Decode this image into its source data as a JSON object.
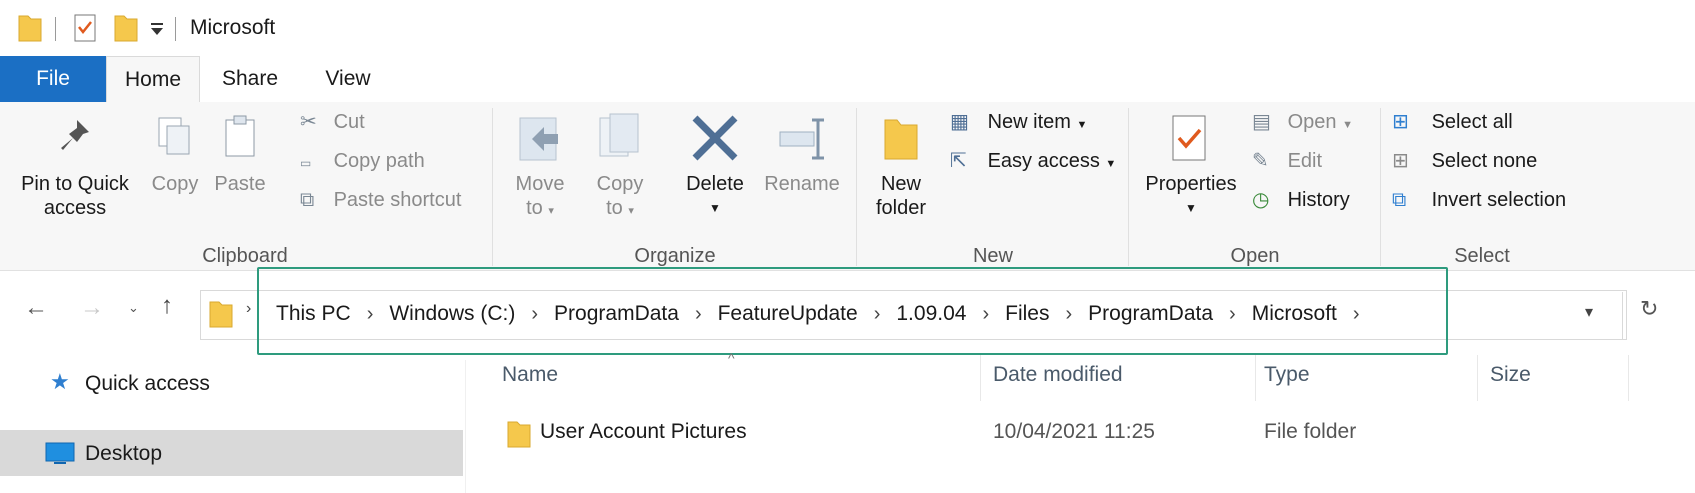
{
  "window": {
    "title": "Microsoft"
  },
  "ribbon_tabs": [
    "File",
    "Home",
    "Share",
    "View"
  ],
  "clipboard": {
    "label": "Clipboard",
    "pin_line1": "Pin to Quick",
    "pin_line2": "access",
    "copy": "Copy",
    "paste": "Paste",
    "cut": "Cut",
    "copy_path": "Copy path",
    "paste_shortcut": "Paste shortcut"
  },
  "organize": {
    "label": "Organize",
    "move_line1": "Move",
    "move_line2": "to",
    "copy_line1": "Copy",
    "copy_line2": "to",
    "delete": "Delete",
    "rename": "Rename"
  },
  "new_group": {
    "label": "New",
    "new_folder_line1": "New",
    "new_folder_line2": "folder",
    "new_item": "New item",
    "easy_access": "Easy access"
  },
  "open_group": {
    "label": "Open",
    "properties": "Properties",
    "open": "Open",
    "edit": "Edit",
    "history": "History"
  },
  "select_group": {
    "label": "Select",
    "select_all": "Select all",
    "select_none": "Select none",
    "invert_selection": "Invert selection"
  },
  "breadcrumb": [
    "This PC",
    "Windows (C:)",
    "ProgramData",
    "FeatureUpdate",
    "1.09.04",
    "Files",
    "ProgramData",
    "Microsoft"
  ],
  "nav": {
    "quick_access": "Quick access",
    "desktop": "Desktop"
  },
  "columns": {
    "name": "Name",
    "date": "Date modified",
    "type": "Type",
    "size": "Size"
  },
  "rows": [
    {
      "name": "User Account Pictures",
      "date": "10/04/2021 11:25",
      "type": "File folder",
      "size": ""
    }
  ],
  "colors": {
    "accent": "#1b6fc4",
    "highlight": "#2e9b7e",
    "folder": "#f5c84c"
  },
  "icons": {
    "folder": "folder-icon",
    "properties": "properties-icon",
    "back": "back-arrow-icon",
    "forward": "forward-arrow-icon",
    "up": "up-arrow-icon",
    "refresh": "refresh-icon"
  }
}
